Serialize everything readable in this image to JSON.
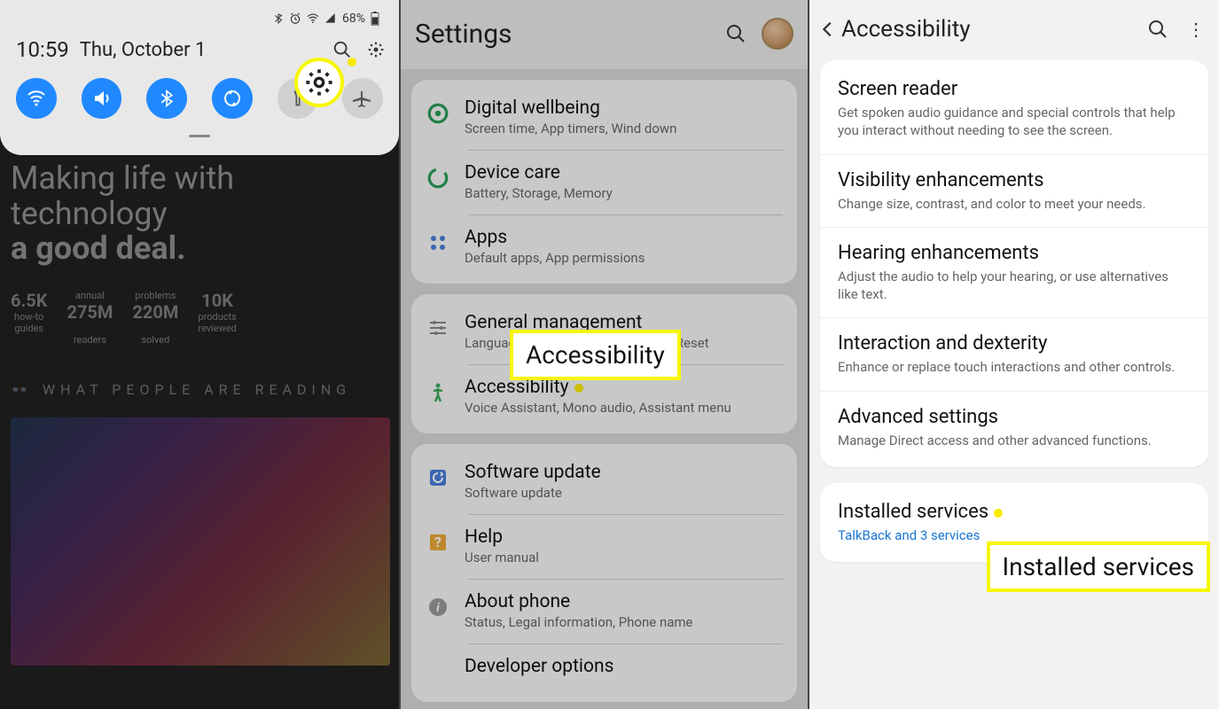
{
  "panel1": {
    "status_icons": [
      "bluetooth-icon",
      "alarm-icon",
      "wifi-icon",
      "signal-icon"
    ],
    "battery_pct": "68%",
    "time": "10:59",
    "date": "Thu, October 1",
    "toggles": [
      {
        "name": "wifi",
        "on": true
      },
      {
        "name": "sound",
        "on": true
      },
      {
        "name": "bluetooth",
        "on": true
      },
      {
        "name": "rotate",
        "on": true
      },
      {
        "name": "flashlight",
        "on": false
      },
      {
        "name": "airplane",
        "on": false
      }
    ],
    "headline_l1": "Making life with",
    "headline_l2": "technology",
    "headline_l3": "a good deal.",
    "stats": [
      {
        "num": "6.5K",
        "l1": "how-to",
        "l2": "guides"
      },
      {
        "num": "275M",
        "l1": "annual",
        "l2": "readers"
      },
      {
        "num": "220M",
        "l1": "problems",
        "l2": "solved"
      },
      {
        "num": "10K",
        "l1": "products",
        "l2": "reviewed"
      }
    ],
    "reading_hdr": "WHAT PEOPLE ARE READING"
  },
  "panel2": {
    "title": "Settings",
    "callout": "Accessibility",
    "groups": [
      [
        {
          "icon": "wellbeing",
          "title": "Digital wellbeing",
          "sub": "Screen time, App timers, Wind down"
        },
        {
          "icon": "devicecare",
          "title": "Device care",
          "sub": "Battery, Storage, Memory"
        },
        {
          "icon": "apps",
          "title": "Apps",
          "sub": "Default apps, App permissions"
        }
      ],
      [
        {
          "icon": "general",
          "title": "General management",
          "sub": "Language and input, Date and time, Reset"
        },
        {
          "icon": "accessibility",
          "title": "Accessibility",
          "sub": "Voice Assistant, Mono audio, Assistant menu"
        }
      ],
      [
        {
          "icon": "software",
          "title": "Software update",
          "sub": "Software update"
        },
        {
          "icon": "help",
          "title": "Help",
          "sub": "User manual"
        },
        {
          "icon": "about",
          "title": "About phone",
          "sub": "Status, Legal information, Phone name"
        },
        {
          "icon": "devopt",
          "title": "Developer options",
          "sub": ""
        }
      ]
    ]
  },
  "panel3": {
    "title": "Accessibility",
    "callout": "Installed services",
    "groups": [
      [
        {
          "title": "Screen reader",
          "sub": "Get spoken audio guidance and special controls that help you interact without needing to see the screen."
        },
        {
          "title": "Visibility enhancements",
          "sub": "Change size, contrast, and color to meet your needs."
        },
        {
          "title": "Hearing enhancements",
          "sub": "Adjust the audio to help your hearing, or use alternatives like text."
        },
        {
          "title": "Interaction and dexterity",
          "sub": "Enhance or replace touch interactions and other controls."
        },
        {
          "title": "Advanced settings",
          "sub": "Manage Direct access and other advanced functions."
        }
      ],
      [
        {
          "title": "Installed services",
          "sub": "TalkBack and 3 services",
          "link": true
        }
      ]
    ]
  }
}
